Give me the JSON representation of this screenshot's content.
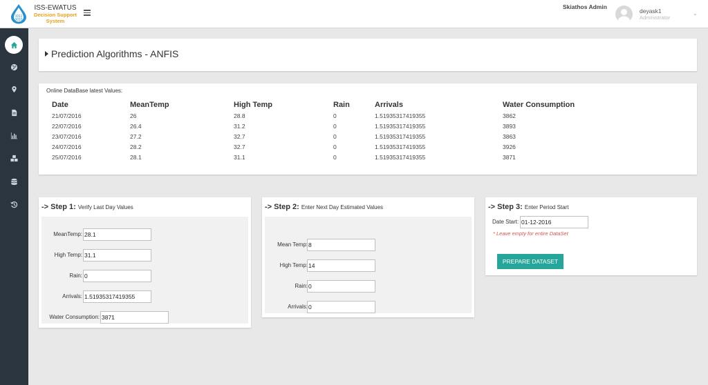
{
  "header": {
    "brand_title": "ISS-EWATUS",
    "brand_subtitle_line1": "Decision Support",
    "brand_subtitle_line2": "System",
    "site_name": "Skiathos Admin",
    "user_name": "deyask1",
    "user_role": "Administrator",
    "user_menu_icon": "chevron-down-icon"
  },
  "sidebar": {
    "items": [
      {
        "icon": "home-icon",
        "active": true
      },
      {
        "icon": "globe-icon"
      },
      {
        "icon": "map-marker-icon"
      },
      {
        "icon": "file-icon"
      },
      {
        "icon": "bar-chart-icon"
      },
      {
        "icon": "cubes-icon"
      },
      {
        "icon": "database-icon"
      },
      {
        "icon": "history-icon"
      }
    ]
  },
  "page": {
    "title": "Prediction Algorithms - ANFIS"
  },
  "table": {
    "caption": "Online DataBase latest Values:",
    "headers": [
      "Date",
      "MeanTemp",
      "High Temp",
      "Rain",
      "Arrivals",
      "Water Consumption"
    ],
    "rows": [
      [
        "21/07/2016",
        "26",
        "28.8",
        "0",
        "1.51935317419355",
        "3862"
      ],
      [
        "22/07/2016",
        "26.4",
        "31.2",
        "0",
        "1.51935317419355",
        "3893"
      ],
      [
        "23/07/2016",
        "27.2",
        "32.7",
        "0",
        "1.51935317419355",
        "3863"
      ],
      [
        "24/07/2016",
        "28.2",
        "32.7",
        "0",
        "1.51935317419355",
        "3926"
      ],
      [
        "25/07/2016",
        "28.1",
        "31.1",
        "0",
        "1.51935317419355",
        "3871"
      ]
    ]
  },
  "step1": {
    "title": "-> Step 1:",
    "subtitle": "Verify Last Day Values",
    "fields": [
      {
        "label": "MeanTemp:",
        "value": "28.1"
      },
      {
        "label": "High Temp:",
        "value": "31.1"
      },
      {
        "label": "Rain:",
        "value": "0"
      },
      {
        "label": "Arrivals:",
        "value": "1.51935317419355"
      },
      {
        "label": "Water Consumption:",
        "value": "3871"
      }
    ]
  },
  "step2": {
    "title": "-> Step 2:",
    "subtitle": "Enter Next Day Estimated Values",
    "fields": [
      {
        "label": "Mean Temp:",
        "value": "8"
      },
      {
        "label": "High Temp:",
        "value": "14"
      },
      {
        "label": "Rain:",
        "value": "0"
      },
      {
        "label": "Arrivals:",
        "value": "0"
      }
    ]
  },
  "step3": {
    "title": "-> Step 3:",
    "subtitle": "Enter Period Start",
    "date_label": "Date Start:",
    "date_value": "01-12-2016",
    "hint": "* Leave empty for entire DataSet",
    "button_label": "PREPARE DATASET"
  },
  "colors": {
    "sidebar_bg": "#2a3540",
    "accent": "#26a69a",
    "brand_orange": "#e6a21e",
    "hint_red": "#d9534f"
  }
}
